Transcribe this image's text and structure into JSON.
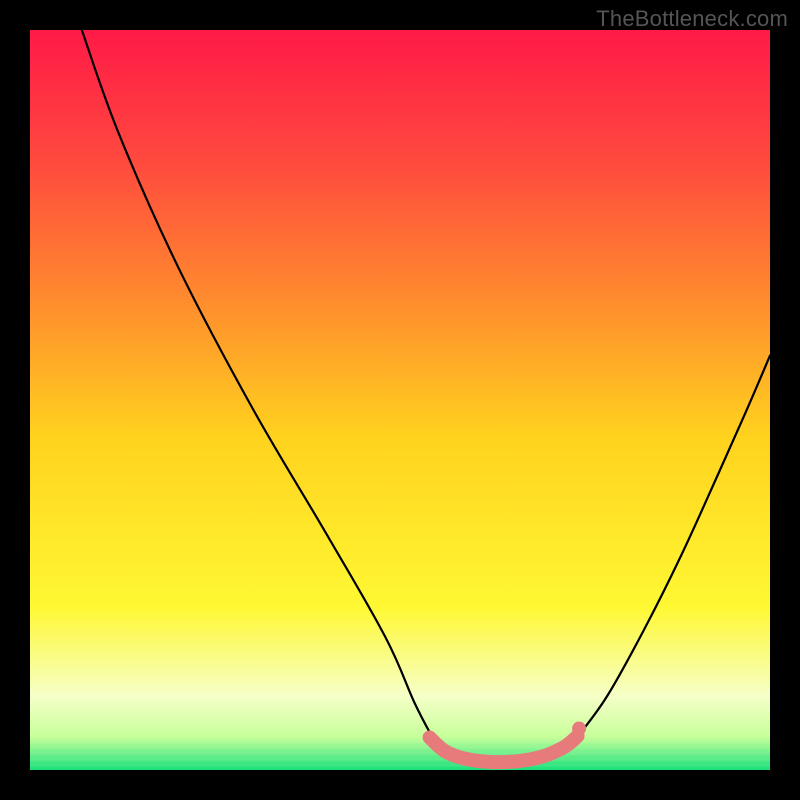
{
  "watermark": "TheBottleneck.com",
  "chart_data": {
    "type": "line",
    "title": "",
    "xlabel": "",
    "ylabel": "",
    "xlim": [
      0,
      100
    ],
    "ylim": [
      0,
      100
    ],
    "background": {
      "kind": "vertical-gradient",
      "stops": [
        {
          "pos": 0.0,
          "color": "#ff1a47"
        },
        {
          "pos": 0.18,
          "color": "#ff4a3e"
        },
        {
          "pos": 0.36,
          "color": "#ff8a2e"
        },
        {
          "pos": 0.55,
          "color": "#ffd21e"
        },
        {
          "pos": 0.78,
          "color": "#fff833"
        },
        {
          "pos": 0.9,
          "color": "#f6ffc8"
        },
        {
          "pos": 0.955,
          "color": "#c7ff9a"
        },
        {
          "pos": 1.0,
          "color": "#18e07a"
        }
      ]
    },
    "series": [
      {
        "name": "bottleneck-curve-left",
        "stroke": "#000000",
        "points": [
          {
            "x": 7.0,
            "y": 100.0
          },
          {
            "x": 12.0,
            "y": 86.0
          },
          {
            "x": 20.0,
            "y": 68.0
          },
          {
            "x": 30.0,
            "y": 49.0
          },
          {
            "x": 40.0,
            "y": 32.0
          },
          {
            "x": 48.0,
            "y": 18.0
          },
          {
            "x": 52.0,
            "y": 9.0
          },
          {
            "x": 54.5,
            "y": 4.2
          }
        ]
      },
      {
        "name": "bottleneck-curve-right",
        "stroke": "#000000",
        "points": [
          {
            "x": 74.0,
            "y": 4.5
          },
          {
            "x": 78.0,
            "y": 10.0
          },
          {
            "x": 83.0,
            "y": 19.0
          },
          {
            "x": 88.0,
            "y": 29.0
          },
          {
            "x": 93.0,
            "y": 40.0
          },
          {
            "x": 97.0,
            "y": 49.0
          },
          {
            "x": 100.0,
            "y": 56.0
          }
        ]
      },
      {
        "name": "valley-band",
        "kind": "thick-band",
        "stroke": "#e77b7b",
        "stroke_width": 14,
        "points": [
          {
            "x": 54.0,
            "y": 4.4
          },
          {
            "x": 56.0,
            "y": 2.6
          },
          {
            "x": 58.5,
            "y": 1.6
          },
          {
            "x": 62.0,
            "y": 1.1
          },
          {
            "x": 66.0,
            "y": 1.2
          },
          {
            "x": 69.5,
            "y": 1.9
          },
          {
            "x": 72.0,
            "y": 3.0
          },
          {
            "x": 73.0,
            "y": 3.7
          },
          {
            "x": 74.0,
            "y": 4.6
          }
        ]
      },
      {
        "name": "valley-right-dot",
        "kind": "marker",
        "stroke": "#e77b7b",
        "radius": 7,
        "points": [
          {
            "x": 74.2,
            "y": 5.6
          }
        ]
      }
    ]
  }
}
